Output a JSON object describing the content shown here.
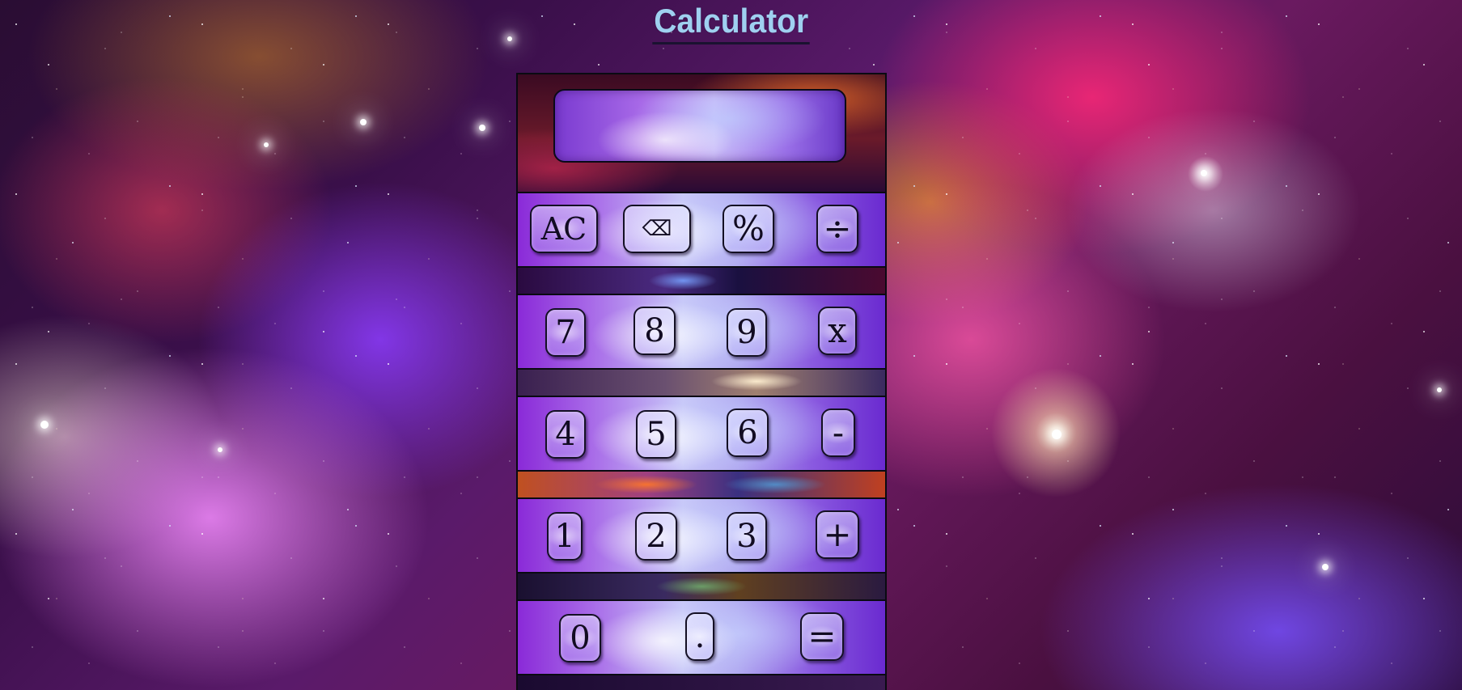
{
  "page": {
    "title": "Calculator"
  },
  "display": {
    "value": ""
  },
  "keypad": {
    "row1": [
      "AC",
      "⌫",
      "%",
      "÷"
    ],
    "row2": [
      "7",
      "8",
      "9",
      "x"
    ],
    "row3": [
      "4",
      "5",
      "6",
      "-"
    ],
    "row4": [
      "1",
      "2",
      "3",
      "+"
    ],
    "row5": [
      "0",
      ".",
      "="
    ]
  },
  "colors": {
    "title": "#9fd0f0",
    "border": "#0a0a12",
    "button_text": "#120c22"
  }
}
